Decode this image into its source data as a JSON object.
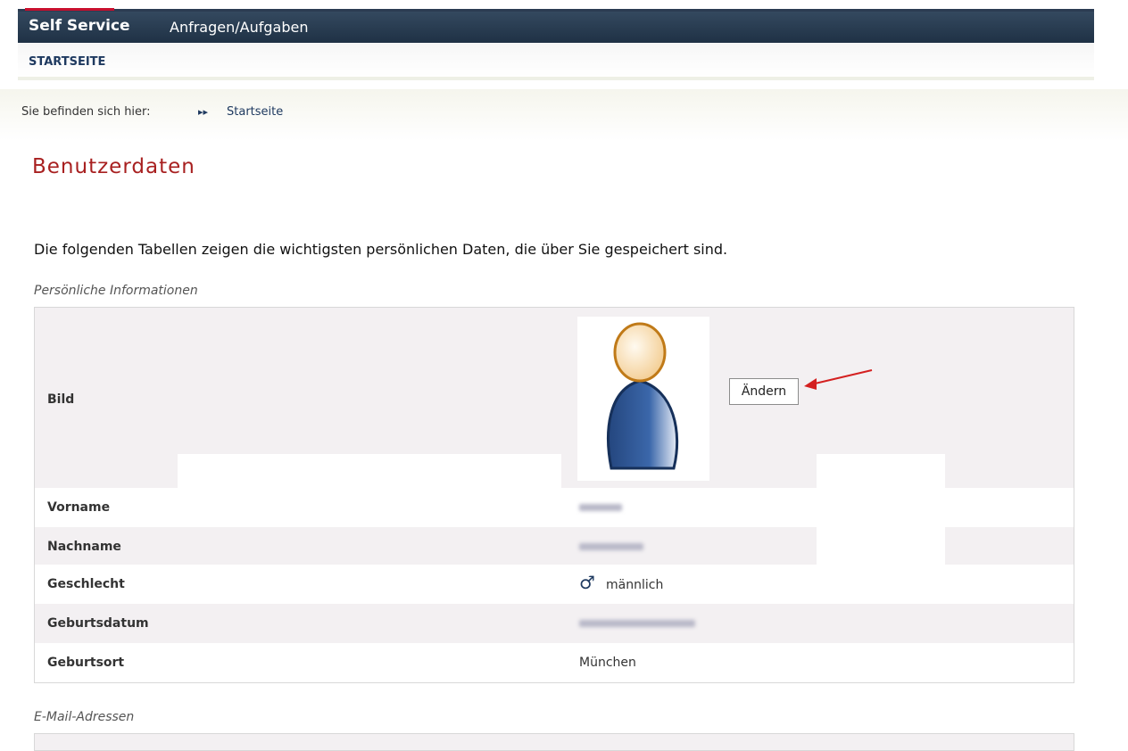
{
  "nav": {
    "tabs": [
      {
        "label": "Self Service",
        "active": true
      },
      {
        "label": "Anfragen/Aufgaben",
        "active": false
      }
    ],
    "subnav_label": "STARTSEITE"
  },
  "breadcrumb": {
    "prefix": "Sie befinden sich hier:",
    "separator_icon": "double-arrow-icon",
    "current": "Startseite"
  },
  "page": {
    "title": "Benutzerdaten",
    "intro": "Die folgenden Tabellen zeigen die wichtigsten persönlichen Daten, die über Sie gespeichert sind."
  },
  "personal": {
    "section_title": "Persönliche Informationen",
    "rows": [
      {
        "label": "Bild",
        "value": "",
        "icon": "default-avatar-icon"
      },
      {
        "label": "Vorname",
        "value": ""
      },
      {
        "label": "Nachname",
        "value": ""
      },
      {
        "label": "Geschlecht",
        "value": "männlich",
        "icon": "male-symbol-icon"
      },
      {
        "label": "Geburtsdatum",
        "value": ""
      },
      {
        "label": "Geburtsort",
        "value": "München"
      }
    ],
    "change_button": "Ändern"
  },
  "email": {
    "section_title": "E-Mail-Adressen"
  },
  "colors": {
    "nav_bg": "#2b3c52",
    "accent_red": "#a82020",
    "link_blue": "#1f3a60",
    "row_alt": "#f3f0f2"
  }
}
